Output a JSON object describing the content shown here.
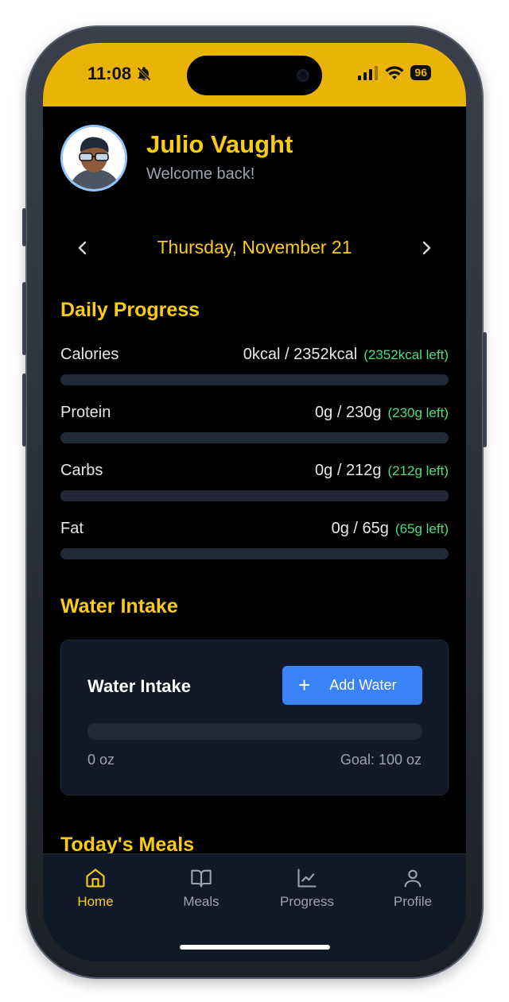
{
  "status_bar": {
    "time": "11:08",
    "battery": "96",
    "bg_color": "#EAB308"
  },
  "user": {
    "name": "Julio Vaught",
    "welcome": "Welcome back!"
  },
  "date_nav": {
    "date": "Thursday, November 21"
  },
  "daily_progress": {
    "title": "Daily Progress",
    "items": [
      {
        "label": "Calories",
        "value": "0kcal / 2352kcal",
        "left": "(2352kcal left)",
        "progress": 0
      },
      {
        "label": "Protein",
        "value": "0g / 230g",
        "left": "(230g left)",
        "progress": 0
      },
      {
        "label": "Carbs",
        "value": "0g / 212g",
        "left": "(212g left)",
        "progress": 0
      },
      {
        "label": "Fat",
        "value": "0g / 65g",
        "left": "(65g left)",
        "progress": 0
      }
    ]
  },
  "water": {
    "section_title": "Water Intake",
    "card_title": "Water Intake",
    "add_button": "Add Water",
    "current": "0 oz",
    "goal": "Goal: 100 oz",
    "progress": 0
  },
  "meals": {
    "title": "Today's Meals"
  },
  "tabs": [
    {
      "label": "Home",
      "icon": "home-icon",
      "active": true
    },
    {
      "label": "Meals",
      "icon": "book-open-icon",
      "active": false
    },
    {
      "label": "Progress",
      "icon": "line-chart-icon",
      "active": false
    },
    {
      "label": "Profile",
      "icon": "user-icon",
      "active": false
    }
  ],
  "colors": {
    "accent": "#FACC15",
    "button_blue": "#3B82F6",
    "remaining_green": "#4ADE80",
    "background": "#000000",
    "card": "#111827"
  }
}
